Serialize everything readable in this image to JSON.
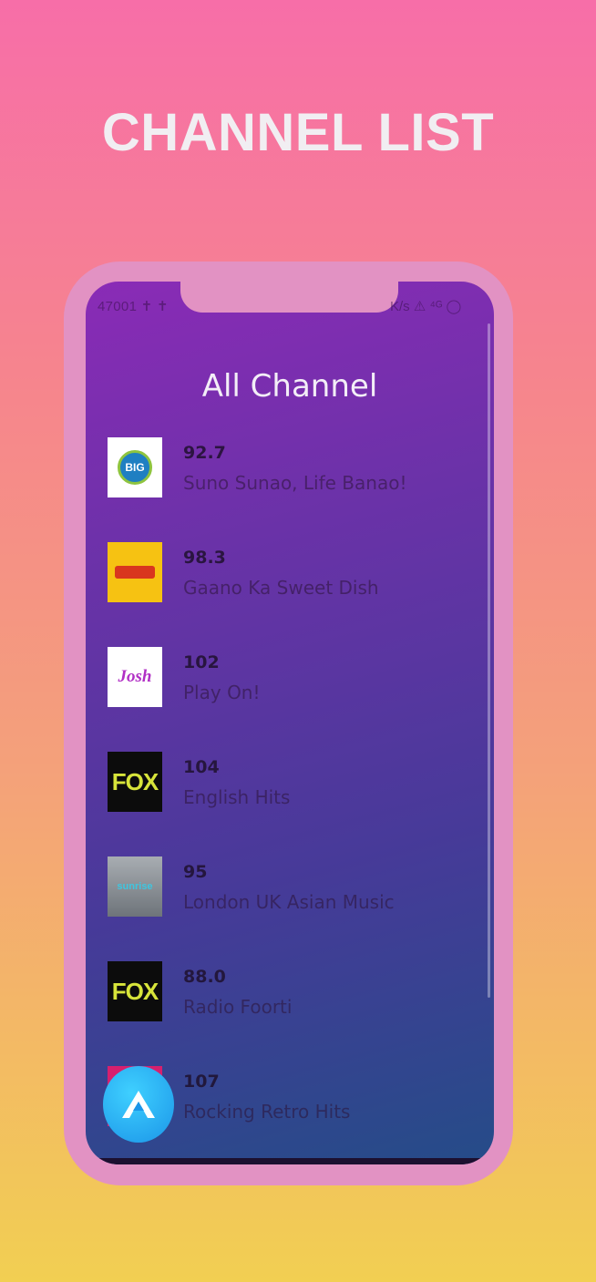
{
  "headline": "CHANNEL LIST",
  "status_bar": {
    "left_text": "47001 ✝ ✝",
    "right_text": "K/s ⚠ ⁴ᴳ ◯"
  },
  "screen_title": "All Channel",
  "channels": [
    {
      "frequency": "92.7",
      "tagline": "Suno Sunao, Life Banao!",
      "logo_text": "BIG"
    },
    {
      "frequency": "98.3",
      "tagline": "Gaano Ka Sweet Dish",
      "logo_text": ""
    },
    {
      "frequency": "102",
      "tagline": "Play On!",
      "logo_text": "Josh"
    },
    {
      "frequency": "104",
      "tagline": "English Hits",
      "logo_text": "FOX"
    },
    {
      "frequency": "95",
      "tagline": "London UK Asian Music",
      "logo_text": "sunrise"
    },
    {
      "frequency": "88.0",
      "tagline": "Radio Foorti",
      "logo_text": "FOX"
    },
    {
      "frequency": "107",
      "tagline": "Rocking Retro Hits",
      "logo_text": ""
    }
  ],
  "colors": {
    "background_top": "#f76ea8",
    "background_bottom": "#f2cf52",
    "phone_frame": "#e292c3",
    "screen_top": "#8a2bb6",
    "screen_bottom": "#254c88",
    "fab": "#2aa8f2"
  },
  "fab_icon": "app-logo-icon"
}
